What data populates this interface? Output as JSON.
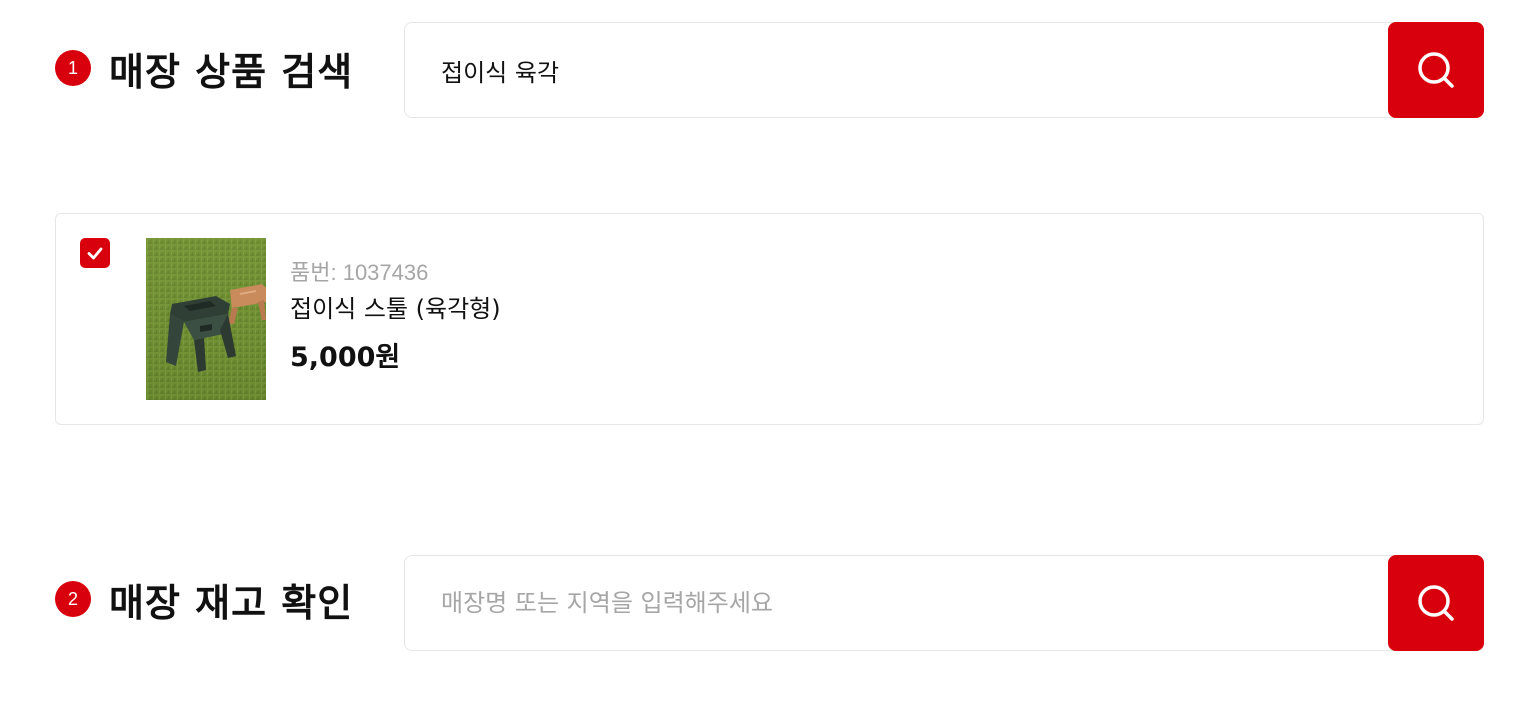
{
  "section1": {
    "step": "1",
    "title": "매장 상품 검색",
    "search_value": "접이식 육각",
    "search_button_icon": "search-icon"
  },
  "product": {
    "checked": true,
    "code": "품번: 1037436",
    "name": "접이식 스툴 (육각형)",
    "price": "5,000원",
    "checkbox_icon": "checkmark-icon"
  },
  "section2": {
    "step": "2",
    "title": "매장 재고 확인",
    "search_value": "",
    "search_placeholder": "매장명 또는 지역을 입력해주세요",
    "search_button_icon": "search-icon"
  },
  "colors": {
    "accent": "#d9000d",
    "border": "#e6e6e6",
    "muted_text": "#a6a6a6",
    "text": "#111111"
  }
}
